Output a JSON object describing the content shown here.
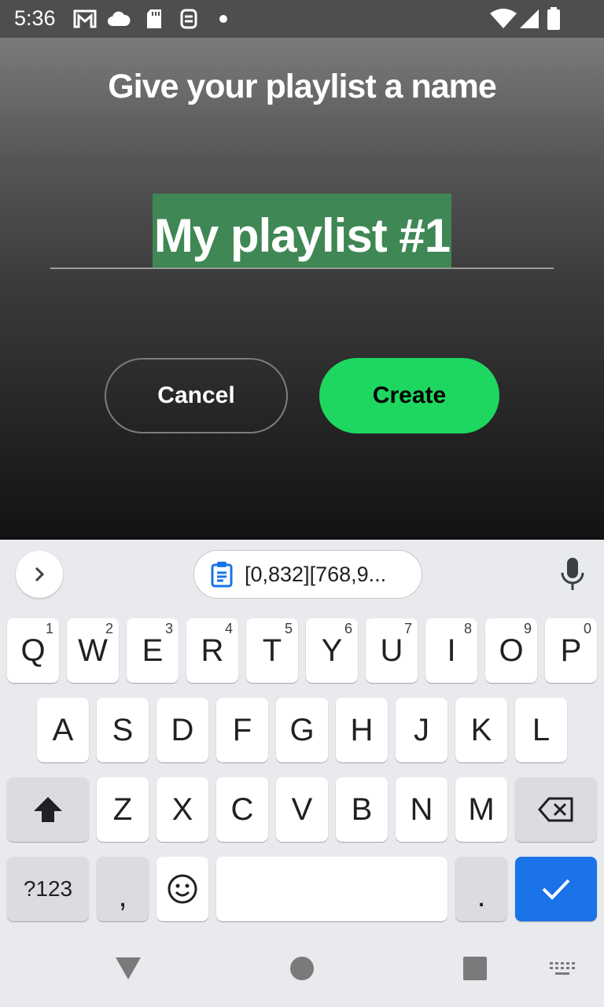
{
  "status_bar": {
    "time": "5:36",
    "left_icons": [
      "gmail-icon",
      "cloud-icon",
      "sd-card-icon",
      "screenshot-icon",
      "dot-icon"
    ],
    "right_icons": [
      "wifi-icon",
      "signal-icon",
      "battery-icon"
    ]
  },
  "dialog": {
    "title": "Give your playlist a name",
    "name_input_value": "My playlist #1",
    "cancel_label": "Cancel",
    "create_label": "Create",
    "accent_color": "#1ed760",
    "selection_color": "#3f8755"
  },
  "keyboard": {
    "clipboard_suggestion": "[0,832][768,9...",
    "rows": [
      [
        {
          "label": "Q",
          "hint": "1"
        },
        {
          "label": "W",
          "hint": "2"
        },
        {
          "label": "E",
          "hint": "3"
        },
        {
          "label": "R",
          "hint": "4"
        },
        {
          "label": "T",
          "hint": "5"
        },
        {
          "label": "Y",
          "hint": "6"
        },
        {
          "label": "U",
          "hint": "7"
        },
        {
          "label": "I",
          "hint": "8"
        },
        {
          "label": "O",
          "hint": "9"
        },
        {
          "label": "P",
          "hint": "0"
        }
      ],
      [
        {
          "label": "A"
        },
        {
          "label": "S"
        },
        {
          "label": "D"
        },
        {
          "label": "F"
        },
        {
          "label": "G"
        },
        {
          "label": "H"
        },
        {
          "label": "J"
        },
        {
          "label": "K"
        },
        {
          "label": "L"
        }
      ],
      [
        {
          "label": "Z"
        },
        {
          "label": "X"
        },
        {
          "label": "C"
        },
        {
          "label": "V"
        },
        {
          "label": "B"
        },
        {
          "label": "N"
        },
        {
          "label": "M"
        }
      ]
    ],
    "symbols_label": "?123",
    "comma_label": ",",
    "period_label": ".",
    "action_color": "#1a73e8"
  },
  "nav_bar": {
    "buttons": [
      "back-icon",
      "home-icon",
      "recents-icon",
      "keyboard-switch-icon"
    ]
  }
}
